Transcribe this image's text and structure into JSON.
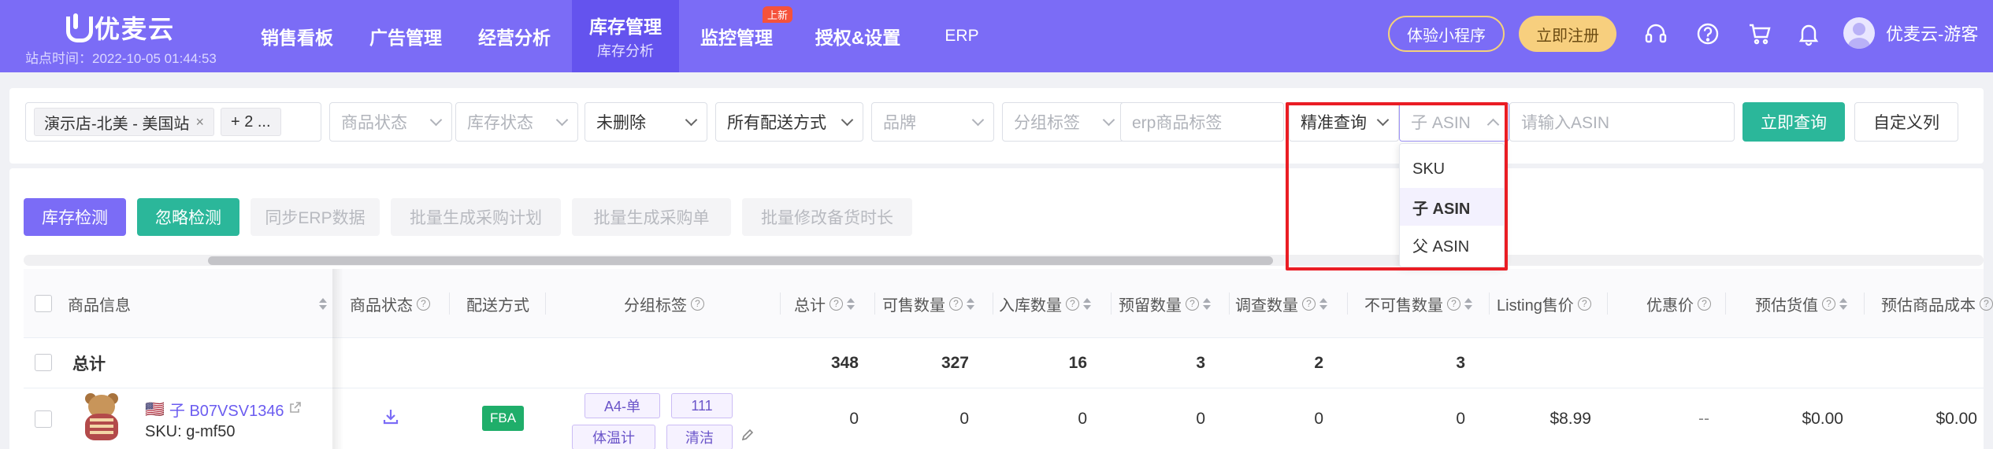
{
  "brand": {
    "name": "优麦云",
    "site_time": "站点时间：2022-10-05 01:44:53"
  },
  "nav": [
    {
      "label": "销售看板",
      "sub": "",
      "badge": ""
    },
    {
      "label": "广告管理",
      "sub": "",
      "badge": ""
    },
    {
      "label": "经营分析",
      "sub": "",
      "badge": ""
    },
    {
      "label": "库存管理",
      "sub": "库存分析",
      "badge": ""
    },
    {
      "label": "监控管理",
      "sub": "",
      "badge": "上新"
    },
    {
      "label": "授权&设置",
      "sub": "",
      "badge": ""
    },
    {
      "label": "ERP",
      "sub": "",
      "badge": ""
    }
  ],
  "top_actions": {
    "mini_program": "体验小程序",
    "register": "立即注册",
    "user": "优麦云-游客"
  },
  "filters": {
    "store_tag": "演示店-北美 - 美国站",
    "store_more": "+ 2 ...",
    "product_status": "商品状态",
    "inventory_status": "库存状态",
    "deleted": "未删除",
    "delivery": "所有配送方式",
    "brand": "品牌",
    "group_tag": "分组标签",
    "erp_tag": "erp商品标签",
    "query_mode": "精准查询",
    "asin_type": "子 ASIN",
    "asin_placeholder": "请输入ASIN",
    "query_button": "立即查询",
    "custom_columns": "自定义列"
  },
  "dropdown_options": [
    "SKU",
    "子 ASIN",
    "父 ASIN"
  ],
  "actions": [
    "库存检测",
    "忽略检测",
    "同步ERP数据",
    "批量生成采购计划",
    "批量生成采购单",
    "批量修改备货时长"
  ],
  "columns": {
    "product_info": "商品信息",
    "product_status": "商品状态",
    "delivery": "配送方式",
    "group_tag": "分组标签",
    "total": "总计",
    "sellable": "可售数量",
    "inbound": "入库数量",
    "reserved": "预留数量",
    "researching": "调查数量",
    "unsellable": "不可售数量",
    "listing_price": "Listing售价",
    "discount_price": "优惠价",
    "est_value": "预估货值",
    "est_cost": "预估商品成本"
  },
  "total_row": {
    "label": "总计",
    "total": "348",
    "sellable": "327",
    "inbound": "16",
    "reserved": "3",
    "researching": "2",
    "unsellable": "3"
  },
  "product_row": {
    "flag": "🇺🇸",
    "asin": "子 B07VSV1346",
    "sku": "SKU: g-mf50",
    "delivery": "FBA",
    "tags": [
      "A4-单",
      "111",
      "体温计",
      "清洁"
    ],
    "total": "0",
    "sellable": "0",
    "inbound": "0",
    "reserved": "0",
    "researching": "0",
    "unsellable": "0",
    "listing_price": "$8.99",
    "discount_price": "--",
    "est_value": "$0.00",
    "est_cost": "$0.00"
  }
}
